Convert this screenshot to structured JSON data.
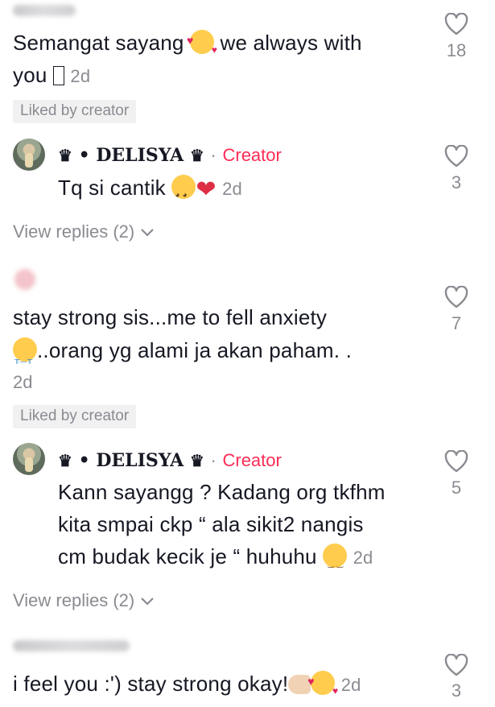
{
  "comments": [
    {
      "text_line1": "Semangat sayang",
      "text_line1b": "we always with",
      "text_line2": "you",
      "time": "2d",
      "likes": "18",
      "liked_badge": "Liked by creator"
    },
    {
      "author": "• DELISYA",
      "creator_sep": "·",
      "creator_label": "Creator",
      "text": "Tq si cantik",
      "time": "2d",
      "likes": "3",
      "view_replies": "View replies (2)"
    },
    {
      "text_line1": "stay strong sis...me to fell anxiety",
      "text_line2": "..orang yg alami ja akan paham. .",
      "time": "2d",
      "likes": "7",
      "liked_badge": "Liked by creator"
    },
    {
      "author": "• DELISYA",
      "creator_sep": "·",
      "creator_label": "Creator",
      "text_line1": "Kann sayangg ? Kadang org tkfhm",
      "text_line2": "kita smpai ckp “ ala sikit2 nangis",
      "text_line3": "cm budak kecik je “ huhuhu",
      "time": "2d",
      "likes": "5",
      "view_replies": "View replies (2)"
    },
    {
      "text": "i feel you :') stay strong okay!",
      "time": "2d",
      "likes": "3"
    }
  ],
  "colors": {
    "creator": "#fe2c55",
    "muted": "#8a8b91",
    "text": "#161823"
  },
  "icons": [
    "heart-outline-icon",
    "chevron-down-icon",
    "crown-icon"
  ]
}
